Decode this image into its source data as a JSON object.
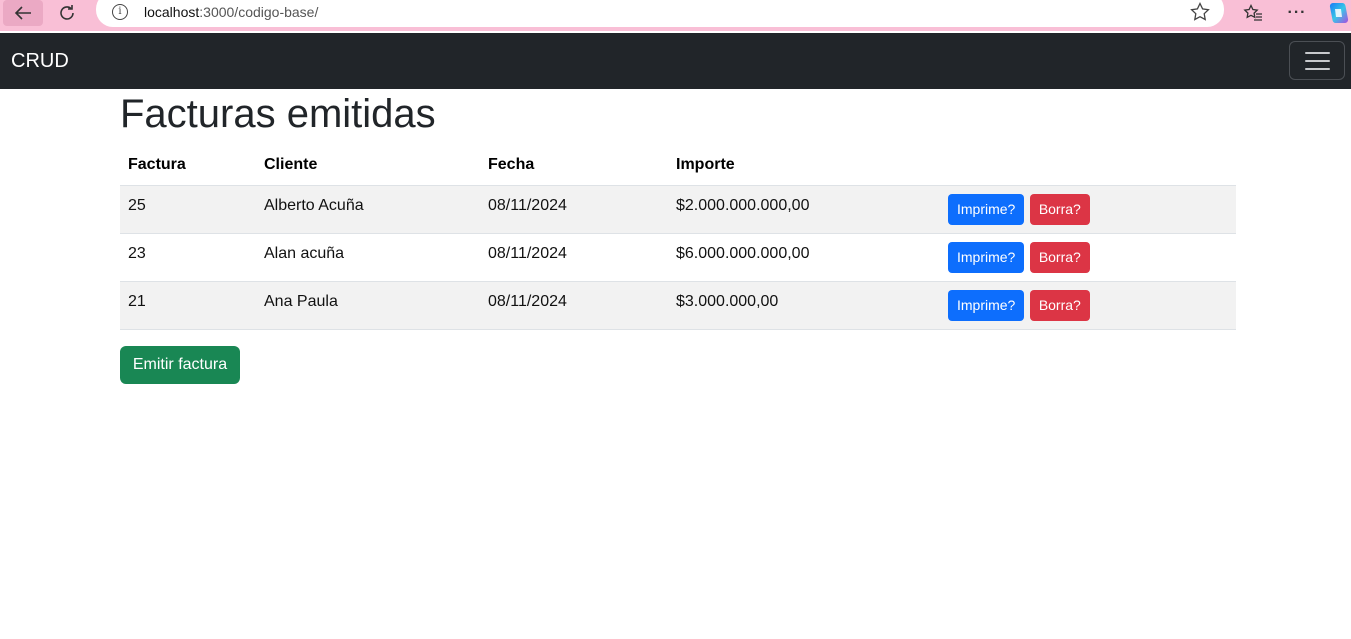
{
  "browser": {
    "url_host": "localhost",
    "url_path": ":3000/codigo-base/"
  },
  "navbar": {
    "brand": "CRUD"
  },
  "main": {
    "title": "Facturas emitidas",
    "columns": [
      "Factura",
      "Cliente",
      "Fecha",
      "Importe"
    ],
    "rows": [
      {
        "factura": "25",
        "cliente": "Alberto Acuña",
        "fecha": "08/11/2024",
        "importe": "$2.000.000.000,00"
      },
      {
        "factura": "23",
        "cliente": "Alan acuña",
        "fecha": "08/11/2024",
        "importe": "$6.000.000.000,00"
      },
      {
        "factura": "21",
        "cliente": "Ana Paula",
        "fecha": "08/11/2024",
        "importe": "$3.000.000,00"
      }
    ],
    "print_label": "Imprime?",
    "delete_label": "Borra?",
    "emit_label": "Emitir factura"
  },
  "colors": {
    "navbar_bg": "#212529",
    "primary": "#0d6efd",
    "danger": "#dc3545",
    "success": "#198754",
    "browser_frame": "#f9bfd6"
  }
}
